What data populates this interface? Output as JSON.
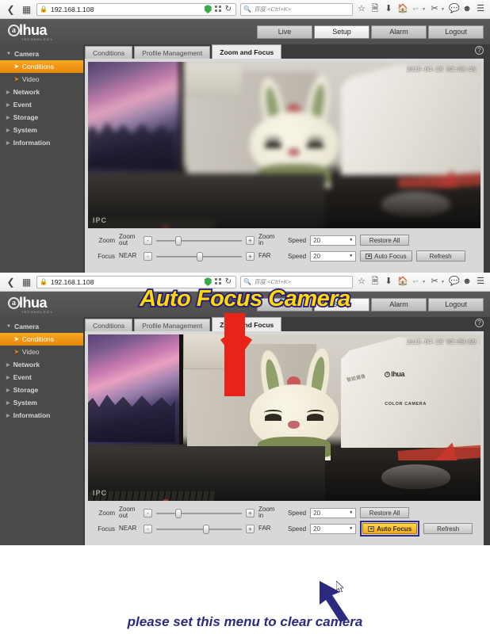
{
  "browser": {
    "url": "192.168.1.108",
    "search_placeholder": "百度 <Ctrl+K>",
    "back_icon": "back-arrow-icon",
    "home_icon": "home-icon",
    "reload_icon": "reload-icon",
    "star_icon": "bookmark-star-icon",
    "reader_icon": "reader-view-icon",
    "download_icon": "download-arrow-icon",
    "menu_icon": "hamburger-menu-icon"
  },
  "app": {
    "logo_letter": "a",
    "logo_word": "lhua",
    "logo_sub": "TECHNOLOGY",
    "header_buttons": [
      {
        "label": "Live",
        "active": false
      },
      {
        "label": "Setup",
        "active": true
      },
      {
        "label": "Alarm",
        "active": false
      },
      {
        "label": "Logout",
        "active": false
      }
    ],
    "help_icon": "?",
    "sidebar": [
      {
        "label": "Camera",
        "type": "group",
        "expanded": true
      },
      {
        "label": "Conditions",
        "type": "sub",
        "active": true
      },
      {
        "label": "Video",
        "type": "sub",
        "active": false
      },
      {
        "label": "Network",
        "type": "group"
      },
      {
        "label": "Event",
        "type": "group"
      },
      {
        "label": "Storage",
        "type": "group"
      },
      {
        "label": "System",
        "type": "group"
      },
      {
        "label": "Information",
        "type": "group"
      }
    ],
    "tabs": [
      {
        "label": "Conditions",
        "active": false
      },
      {
        "label": "Profile Management",
        "active": false
      },
      {
        "label": "Zoom and Focus",
        "active": true
      }
    ]
  },
  "window_top": {
    "timestamp": "2015-04-19 02:08:46",
    "watermark": "IPC",
    "focused": false,
    "controls": {
      "zoom_label": "Zoom",
      "zoom_out": "Zoom out",
      "zoom_out_l1": "Zoom",
      "zoom_out_l2": "out",
      "zoom_in_l1": "Zoom",
      "zoom_in_l2": "in",
      "minus": "-",
      "plus": "+",
      "speed_label": "Speed",
      "zoom_speed_value": "20",
      "restore_all": "Restore All",
      "focus_label": "Focus",
      "near": "NEAR",
      "far": "FAR",
      "focus_speed_value": "20",
      "auto_focus": "Auto Focus",
      "refresh": "Refresh",
      "zoom_knob_pct": 22,
      "focus_knob_pct": 47
    }
  },
  "window_bottom": {
    "timestamp": "2015-04-19 02:09:50",
    "watermark": "IPC",
    "focused": true,
    "box_logo_letter": "a",
    "box_logo_word": "lhua",
    "box_text": "COLOR CAMERA",
    "controls": {
      "zoom_label": "Zoom",
      "zoom_out_l1": "Zoom",
      "zoom_out_l2": "out",
      "zoom_in_l1": "Zoom",
      "zoom_in_l2": "in",
      "minus": "-",
      "plus": "+",
      "speed_label": "Speed",
      "zoom_speed_value": "20",
      "restore_all": "Restore All",
      "focus_label": "Focus",
      "near": "NEAR",
      "far": "FAR",
      "focus_speed_value": "20",
      "auto_focus": "Auto Focus",
      "refresh": "Refresh",
      "zoom_knob_pct": 22,
      "focus_knob_pct": 55
    }
  },
  "annotations": {
    "banner": "Auto Focus Camera",
    "bottom_note": "please set this menu to clear camera",
    "banner_fill": "#ffd900",
    "banner_stroke": "#231a7a",
    "arrow_color": "#e8241a",
    "highlight_border": "#2f2b86",
    "highlight_fill": "#f5bb1c",
    "note_color": "#2c2a7e"
  }
}
